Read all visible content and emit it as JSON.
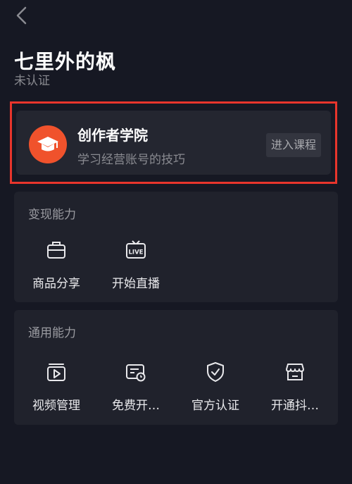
{
  "header": {
    "name": "七里外的枫",
    "status": "未认证"
  },
  "academy": {
    "title": "创作者学院",
    "description": "学习经营账号的技巧",
    "button_label": "进入课程",
    "icon": "graduation-cap-icon",
    "highlight_color": "#e8352c",
    "icon_bg_color": "#f0522c"
  },
  "monetization": {
    "title": "变现能力",
    "items": [
      {
        "label": "商品分享",
        "icon": "briefcase-icon"
      },
      {
        "label": "开始直播",
        "icon": "live-tv-icon"
      }
    ]
  },
  "general": {
    "title": "通用能力",
    "items": [
      {
        "label": "视频管理",
        "icon": "video-folder-icon"
      },
      {
        "label": "免费开…",
        "icon": "card-clock-icon"
      },
      {
        "label": "官方认证",
        "icon": "shield-check-icon"
      },
      {
        "label": "开通抖…",
        "icon": "shop-icon"
      }
    ]
  }
}
